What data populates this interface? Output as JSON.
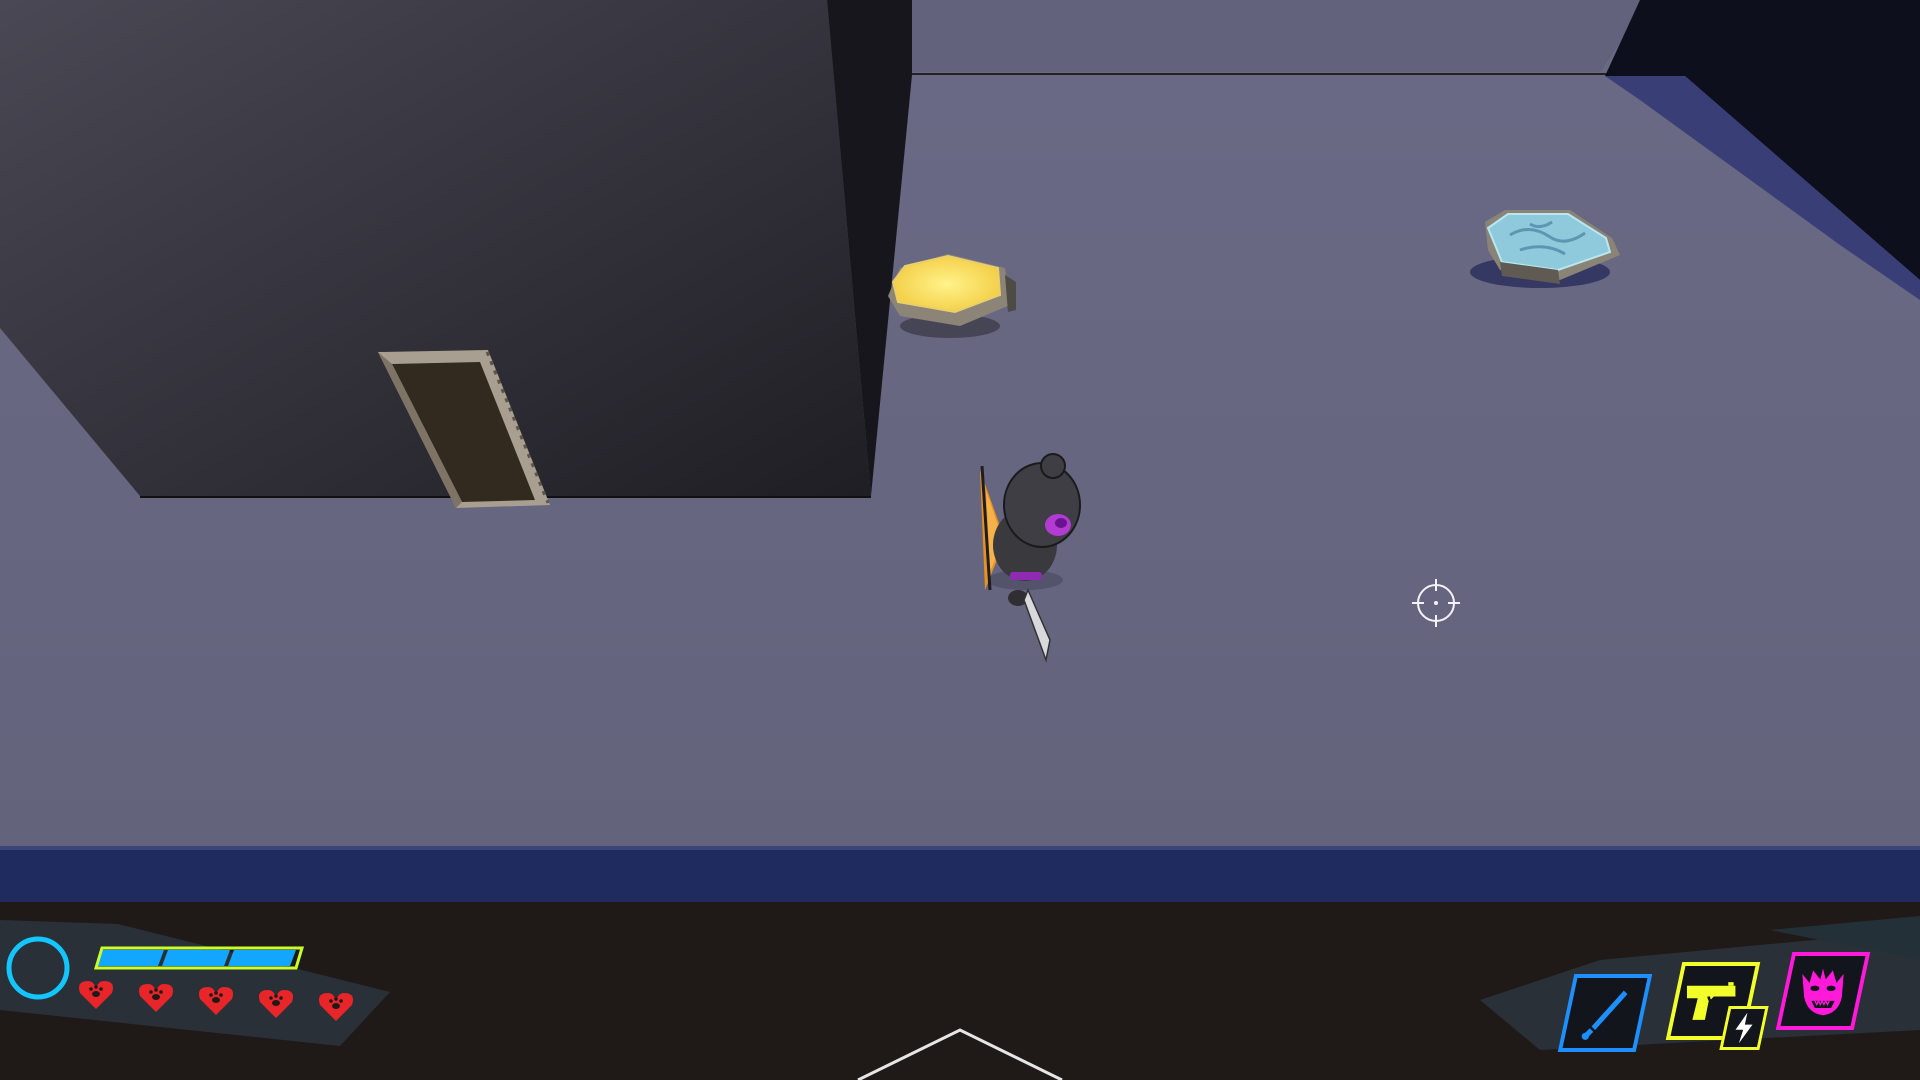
{
  "hud": {
    "stamina": {
      "segments": 3,
      "filled": 3
    },
    "lives": {
      "count": 5,
      "icon": "paw-heart-icon"
    },
    "abilities": [
      {
        "id": "knife",
        "icon": "knife-icon",
        "color": "#1e8fff"
      },
      {
        "id": "gun",
        "icon": "pistol-icon",
        "color": "#f2ff2a",
        "badge": "lightning-icon"
      },
      {
        "id": "beast",
        "icon": "beast-face-icon",
        "color": "#ff19d8"
      }
    ]
  },
  "world": {
    "pads": [
      {
        "name": "yellow-hex-pad",
        "color": "#f7e36a"
      },
      {
        "name": "blue-hex-pad",
        "color": "#8fc9dc"
      }
    ]
  },
  "colors": {
    "floor": "#666680",
    "wall_dark": "#2e2d35",
    "hud_bg": "#1f1a17",
    "stamina": "#12a6ff",
    "stamina_outline": "#c8ff2a",
    "ring": "#13c6ff",
    "heart": "#e8262a"
  }
}
